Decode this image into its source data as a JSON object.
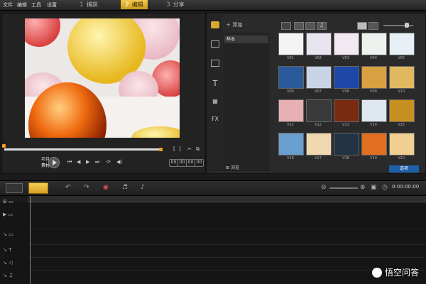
{
  "menu": {
    "file": "文件",
    "edit": "编辑",
    "tools": "工具",
    "settings": "设置"
  },
  "steps": [
    {
      "num": "1",
      "label": "捕获"
    },
    {
      "num": "2",
      "label": "编辑"
    },
    {
      "num": "3",
      "label": "分享"
    }
  ],
  "preview": {
    "project_label": "项目",
    "clip_label": "素材",
    "timecode": "00:00:00"
  },
  "library": {
    "add_label": "添加",
    "folder_name": "样本",
    "browse_label": "浏览",
    "apply_label": "选项",
    "side_icons": [
      "media-icon",
      "instant-project-icon",
      "transition-icon",
      "title-icon",
      "graphic-icon",
      "filter-icon"
    ],
    "fx_label": "FX",
    "thumbs": [
      {
        "label": "V01",
        "color": "#f4f4f4"
      },
      {
        "label": "V02",
        "color": "#e8e4f0"
      },
      {
        "label": "V03",
        "color": "#f2e8f2"
      },
      {
        "label": "V04",
        "color": "#eef2ee"
      },
      {
        "label": "V05",
        "color": "#e6f0f6"
      },
      {
        "label": "V06",
        "color": "#2b5a9a"
      },
      {
        "label": "V07",
        "color": "#c9d4e6"
      },
      {
        "label": "V08",
        "color": "#1f47a8"
      },
      {
        "label": "V09",
        "color": "#d8a040"
      },
      {
        "label": "V10",
        "color": "#e0b860"
      },
      {
        "label": "V11",
        "color": "#e8b0b4"
      },
      {
        "label": "V12",
        "color": "#3a3a3a"
      },
      {
        "label": "V13",
        "color": "#7a2a10"
      },
      {
        "label": "V14",
        "color": "#dfe8f0"
      },
      {
        "label": "V15",
        "color": "#c89020"
      },
      {
        "label": "V16",
        "color": "#6aa0d0"
      },
      {
        "label": "V17",
        "color": "#f0d8b0"
      },
      {
        "label": "V18",
        "color": "#223344"
      },
      {
        "label": "V19",
        "color": "#e07020"
      },
      {
        "label": "V20",
        "color": "#f0d090"
      }
    ]
  },
  "timeline": {
    "timecode": "0:00:00:00",
    "track_icons": [
      "video-track-icon",
      "overlay-track-icon",
      "title-track-icon",
      "voice-track-icon",
      "music-track-icon"
    ]
  },
  "watermark": {
    "text": "悟空问答"
  }
}
